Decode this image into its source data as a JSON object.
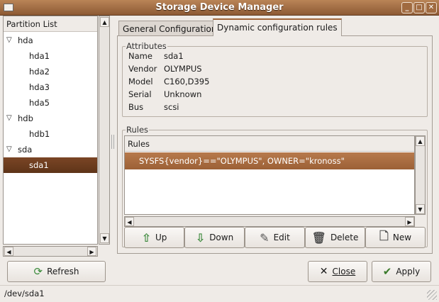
{
  "window": {
    "title": "Storage Device Manager",
    "minimize": "_",
    "maximize": "□",
    "close": "✕"
  },
  "sidebar": {
    "header": "Partition List",
    "items": [
      {
        "label": "hda",
        "level": 0,
        "expanded": true
      },
      {
        "label": "hda1",
        "level": 1
      },
      {
        "label": "hda2",
        "level": 1
      },
      {
        "label": "hda3",
        "level": 1
      },
      {
        "label": "hda5",
        "level": 1
      },
      {
        "label": "hdb",
        "level": 0,
        "expanded": true
      },
      {
        "label": "hdb1",
        "level": 1
      },
      {
        "label": "sda",
        "level": 0,
        "expanded": true
      },
      {
        "label": "sda1",
        "level": 1,
        "selected": true
      }
    ],
    "refresh_label": "Refresh"
  },
  "tabs": [
    {
      "label": "General Configuration"
    },
    {
      "label": "Dynamic configuration rules",
      "active": true
    }
  ],
  "attributes": {
    "title": "Attributes",
    "rows": [
      {
        "key": "Name",
        "value": "sda1"
      },
      {
        "key": "Vendor",
        "value": "OLYMPUS"
      },
      {
        "key": "Model",
        "value": "C160,D395"
      },
      {
        "key": "Serial",
        "value": "Unknown"
      },
      {
        "key": "Bus",
        "value": "scsi"
      }
    ]
  },
  "rules": {
    "title": "Rules",
    "column": "Rules",
    "rows": [
      "SYSFS{vendor}==\"OLYMPUS\", OWNER=\"kronoss\""
    ],
    "buttons": [
      {
        "label": "Up",
        "icon": "arrow-up-icon"
      },
      {
        "label": "Down",
        "icon": "arrow-down-icon"
      },
      {
        "label": "Edit",
        "icon": "edit-icon"
      },
      {
        "label": "Delete",
        "icon": "trash-icon"
      },
      {
        "label": "New",
        "icon": "new-file-icon"
      }
    ]
  },
  "footer": {
    "close_label": "Close",
    "apply_label": "Apply"
  },
  "status": "/dev/sda1",
  "colors": {
    "accent": "#a0653a",
    "selection": "#6b3b1e"
  }
}
